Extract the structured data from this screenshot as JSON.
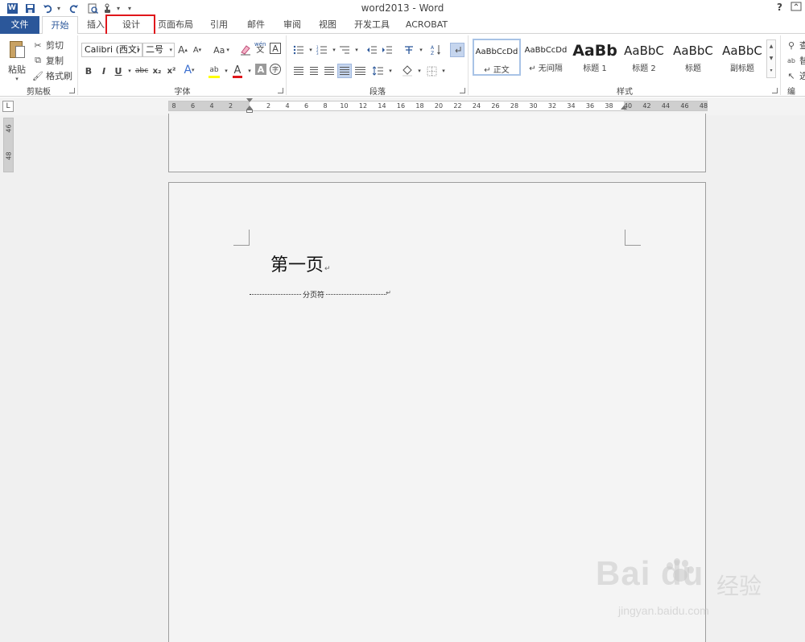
{
  "window": {
    "title": "word2013 - Word",
    "help": "?"
  },
  "qat": {
    "word_icon": "W",
    "save_icon": "save-icon",
    "undo_icon": "undo-icon",
    "redo_icon": "redo-icon",
    "print_preview_icon": "print-preview-icon",
    "touch_icon": "touch-mode-icon",
    "customize_icon": "customize-qat-icon"
  },
  "tabs": [
    {
      "label": "文件"
    },
    {
      "label": "开始"
    },
    {
      "label": "插入"
    },
    {
      "label": "设计"
    },
    {
      "label": "页面布局"
    },
    {
      "label": "引用"
    },
    {
      "label": "邮件"
    },
    {
      "label": "审阅"
    },
    {
      "label": "视图"
    },
    {
      "label": "开发工具"
    },
    {
      "label": "ACROBAT"
    }
  ],
  "ribbon": {
    "clipboard": {
      "group_label": "剪贴板",
      "paste": "粘贴",
      "cut": "剪切",
      "copy": "复制",
      "format_painter": "格式刷"
    },
    "font": {
      "group_label": "字体",
      "font_name": "Calibri (西文i",
      "font_size": "二号",
      "grow": "A",
      "shrink": "A",
      "change_case": "Aa",
      "phonetic_top": "wén",
      "phonetic_bottom": "文",
      "border_char": "A",
      "bold": "B",
      "italic": "I",
      "underline": "U",
      "strike": "abc",
      "subscript": "x₂",
      "superscript": "x²",
      "text_effects": "A",
      "highlight": "ab",
      "font_color": "A",
      "char_shading": "A",
      "enclose": "字",
      "highlight_color": "#ffff00",
      "font_color_value": "#e0161b"
    },
    "paragraph": {
      "group_label": "段落"
    },
    "styles": {
      "group_label": "样式",
      "items": [
        {
          "sample": "AaBbCcDd",
          "name": "↵ 正文"
        },
        {
          "sample": "AaBbCcDd",
          "name": "↵ 无间隔"
        },
        {
          "sample": "AaBb",
          "name": "标题 1"
        },
        {
          "sample": "AaBbC",
          "name": "标题 2"
        },
        {
          "sample": "AaBbC",
          "name": "标题"
        },
        {
          "sample": "AaBbC",
          "name": "副标题"
        }
      ]
    },
    "editing": {
      "find": "查",
      "replace": "替",
      "select": "选",
      "group_label": "编"
    }
  },
  "ruler": {
    "tab_selector": "L",
    "left_numbers": [
      "8",
      "6",
      "4",
      "2"
    ],
    "right_numbers": [
      "2",
      "4",
      "6",
      "8",
      "10",
      "12",
      "14",
      "16",
      "18",
      "20",
      "22",
      "24",
      "26",
      "28",
      "30",
      "32",
      "34",
      "36",
      "38",
      "40",
      "42",
      "44",
      "46",
      "48"
    ],
    "vertical_numbers": [
      "46",
      "48"
    ]
  },
  "document": {
    "heading_text": "第一页",
    "paragraph_mark": "↵",
    "page_break_label": "分页符",
    "page_break_mark": "↵"
  },
  "watermark": {
    "logo": "Bai  du",
    "chinese": "经验",
    "url": "jingyan.baidu.com"
  },
  "colors": {
    "accent": "#2b579a",
    "highlight_box": "#e0161b"
  }
}
